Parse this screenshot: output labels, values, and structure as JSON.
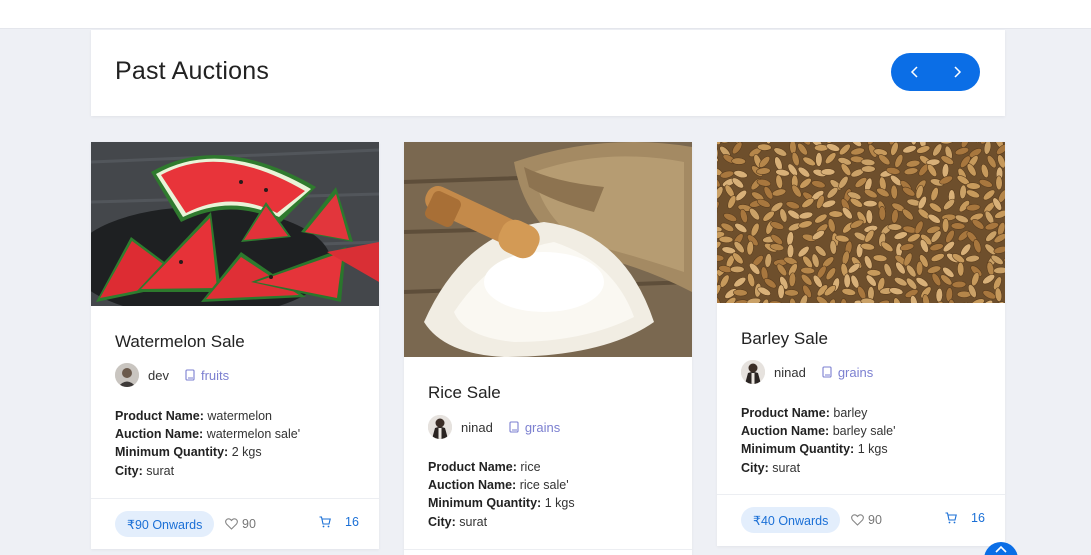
{
  "header": {
    "title": "Past Auctions",
    "prev_icon": "chevron-left-icon",
    "next_icon": "chevron-right-icon",
    "accent_color": "#0b6ee6"
  },
  "auctions": [
    {
      "title": "Watermelon Sale",
      "author": "dev",
      "category": "fruits",
      "product_name_label": "Product Name:",
      "product_name": "watermelon",
      "auction_name_label": "Auction Name:",
      "auction_name": "watermelon sale'",
      "min_qty_label": "Minimum Quantity:",
      "min_qty": "2 kgs",
      "city_label": "City:",
      "city": "surat",
      "price": "₹90 Onwards",
      "likes": "90",
      "bids": "16",
      "image": "watermelon-slices"
    },
    {
      "title": "Rice Sale",
      "author": "ninad",
      "category": "grains",
      "product_name_label": "Product Name:",
      "product_name": "rice",
      "auction_name_label": "Auction Name:",
      "auction_name": "rice sale'",
      "min_qty_label": "Minimum Quantity:",
      "min_qty": "1 kgs",
      "city_label": "City:",
      "city": "surat",
      "image": "rice-sack"
    },
    {
      "title": "Barley Sale",
      "author": "ninad",
      "category": "grains",
      "product_name_label": "Product Name:",
      "product_name": "barley",
      "auction_name_label": "Auction Name:",
      "auction_name": "barley sale'",
      "min_qty_label": "Minimum Quantity:",
      "min_qty": "1 kgs",
      "city_label": "City:",
      "city": "surat",
      "price": "₹40 Onwards",
      "likes": "90",
      "bids": "16",
      "image": "barley-grains"
    }
  ],
  "icons": {
    "category": "book-icon",
    "likes": "heart-icon",
    "bids": "cart-icon",
    "scroll_top": "chevron-up-icon"
  }
}
